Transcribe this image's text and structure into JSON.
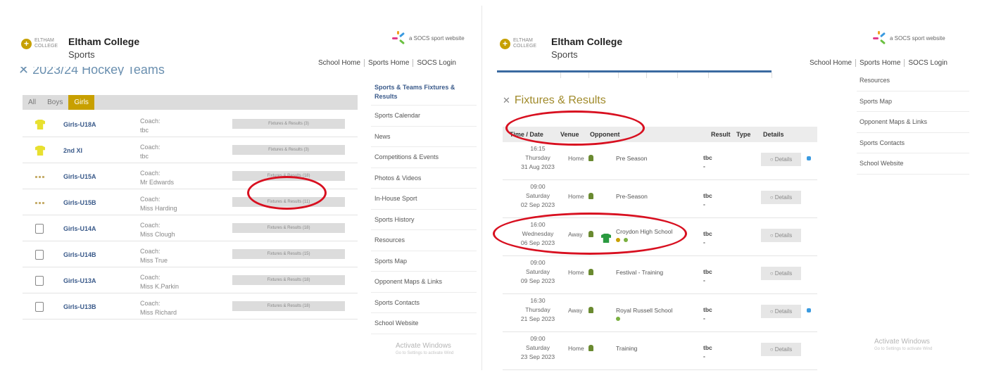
{
  "colors": {
    "accent_gold": "#c8a000",
    "link_blue": "#3a5a8a",
    "annotation_red": "#d81020"
  },
  "left": {
    "logo_text": "ELTHAM COLLEGE",
    "site_title": "Eltham College",
    "site_subtitle": "Sports",
    "socs_label": "a SOCS sport website",
    "toplinks": [
      "School Home",
      "Sports Home",
      "SOCS Login"
    ],
    "section_title": "2023/24 Hockey Teams",
    "filters": [
      "All",
      "Boys",
      "Girls"
    ],
    "active_filter": "Girls",
    "teams": [
      {
        "name": "Girls-U18A",
        "coach_label": "Coach:",
        "coach": "tbc",
        "button": "Fixtures & Results (3)",
        "kit": "yellow"
      },
      {
        "name": "2nd XI",
        "coach_label": "Coach:",
        "coach": "tbc",
        "button": "Fixtures & Results (3)",
        "kit": "yellow"
      },
      {
        "name": "Girls-U15A",
        "coach_label": "Coach:",
        "coach": "Mr Edwards",
        "button": "Fixtures & Results (18)",
        "kit": "dots"
      },
      {
        "name": "Girls-U15B",
        "coach_label": "Coach:",
        "coach": "Miss Harding",
        "button": "Fixtures & Results (11)",
        "kit": "dots"
      },
      {
        "name": "Girls-U14A",
        "coach_label": "Coach:",
        "coach": "Miss Clough",
        "button": "Fixtures & Results (18)",
        "kit": "outline"
      },
      {
        "name": "Girls-U14B",
        "coach_label": "Coach:",
        "coach": "Miss True",
        "button": "Fixtures & Results (15)",
        "kit": "outline"
      },
      {
        "name": "Girls-U13A",
        "coach_label": "Coach:",
        "coach": "Miss K.Parkin",
        "button": "Fixtures & Results (18)",
        "kit": "outline"
      },
      {
        "name": "Girls-U13B",
        "coach_label": "Coach:",
        "coach": "Miss Richard",
        "button": "Fixtures & Results (18)",
        "kit": "outline"
      }
    ],
    "nav_first": "Sports & Teams Fixtures & Results",
    "nav": [
      "Sports Calendar",
      "News",
      "Competitions & Events",
      "Photos & Videos",
      "In-House Sport",
      "Sports History",
      "Resources",
      "Sports Map",
      "Opponent Maps & Links",
      "Sports Contacts",
      "School Website"
    ],
    "watermark_line1": "Activate Windows",
    "watermark_line2": "Go to Settings to activate Wind"
  },
  "right": {
    "logo_text": "ELTHAM COLLEGE",
    "site_title": "Eltham College",
    "site_subtitle": "Sports",
    "socs_label": "a SOCS sport website",
    "toplinks": [
      "School Home",
      "Sports Home",
      "SOCS Login"
    ],
    "section_title": "Fixtures & Results",
    "headers": {
      "time": "Time / Date",
      "venue": "Venue",
      "opponent": "Opponent",
      "result": "Result",
      "type": "Type",
      "details": "Details"
    },
    "fixtures": [
      {
        "time": "16:15",
        "day": "Thursday",
        "date": "31 Aug 2023",
        "venue": "Home",
        "opponent": "Pre Season",
        "result": "tbc",
        "result_sub": "-",
        "details": "Details",
        "shirt": false,
        "tw": true
      },
      {
        "time": "09:00",
        "day": "Saturday",
        "date": "02 Sep 2023",
        "venue": "Home",
        "opponent": "Pre-Season",
        "result": "tbc",
        "result_sub": "-",
        "details": "Details",
        "shirt": false,
        "tw": false
      },
      {
        "time": "16:00",
        "day": "Wednesday",
        "date": "06 Sep 2023",
        "venue": "Away",
        "opponent": "Croydon High School",
        "result": "tbc",
        "result_sub": "-",
        "details": "Details",
        "shirt": true,
        "tw": false
      },
      {
        "time": "09:00",
        "day": "Saturday",
        "date": "09 Sep 2023",
        "venue": "Home",
        "opponent": "Festival - Training",
        "result": "tbc",
        "result_sub": "-",
        "details": "Details",
        "shirt": false,
        "tw": false
      },
      {
        "time": "16:30",
        "day": "Thursday",
        "date": "21 Sep 2023",
        "venue": "Away",
        "opponent": "Royal Russell School",
        "result": "tbc",
        "result_sub": "-",
        "details": "Details",
        "shirt": false,
        "tw": true
      },
      {
        "time": "09:00",
        "day": "Saturday",
        "date": "23 Sep 2023",
        "venue": "Home",
        "opponent": "Training",
        "result": "tbc",
        "result_sub": "-",
        "details": "Details",
        "shirt": false,
        "tw": false
      }
    ],
    "nav": [
      "Resources",
      "Sports Map",
      "Opponent Maps & Links",
      "Sports Contacts",
      "School Website"
    ],
    "watermark_line1": "Activate Windows",
    "watermark_line2": "Go to Settings to activate Wind"
  }
}
